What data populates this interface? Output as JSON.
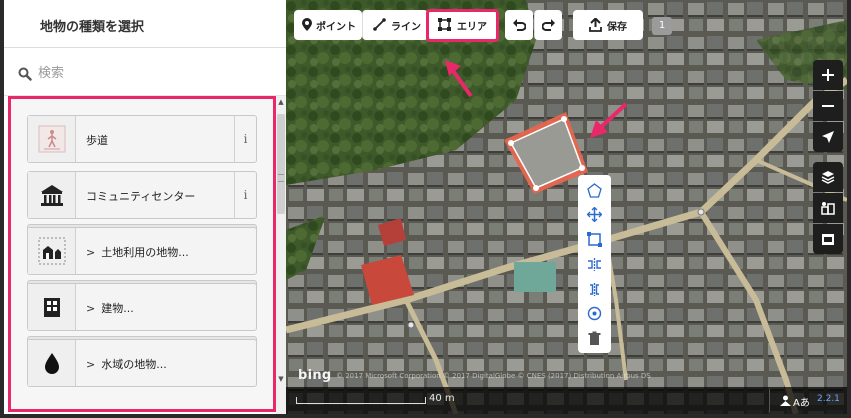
{
  "sidebar": {
    "title": "地物の種類を選択",
    "search": {
      "placeholder": "検索",
      "value": ""
    },
    "presets": [
      {
        "label": "歩道",
        "type": "preset",
        "icon": "pedestrian-icon",
        "info": "i"
      },
      {
        "label": "コミュニティセンター",
        "type": "preset",
        "icon": "community-center-icon",
        "info": "i"
      },
      {
        "label": "土地利用の地物...",
        "type": "category",
        "icon": "landuse-icon",
        "chevron": ">"
      },
      {
        "label": "建物...",
        "type": "category",
        "icon": "building-icon",
        "chevron": ">"
      },
      {
        "label": "水域の地物...",
        "type": "category",
        "icon": "water-drop-icon",
        "chevron": ">"
      }
    ]
  },
  "toolbar": {
    "point_label": "ポイント",
    "line_label": "ライン",
    "area_label": "エリア",
    "save_label": "保存",
    "edit_count": "1",
    "highlight_color": "#e9286a"
  },
  "map_controls": [
    "zoom-in-icon",
    "zoom-out-icon",
    "geolocate-icon",
    "layers-icon",
    "map-data-icon",
    "issues-icon"
  ],
  "edit_menu": [
    "continue-icon",
    "move-icon",
    "square-icon",
    "reflect-long-icon",
    "reflect-short-icon",
    "circularize-icon",
    "delete-icon"
  ],
  "footer": {
    "scale_label": "40 m",
    "imagery_logo": "bing",
    "copyright": "© 2017 Microsoft Corporation © 2017 DigitalGlobe © CNES (2017) Distribution Airbus DS",
    "lang_label": "Aあ",
    "version": "2.2.1"
  }
}
